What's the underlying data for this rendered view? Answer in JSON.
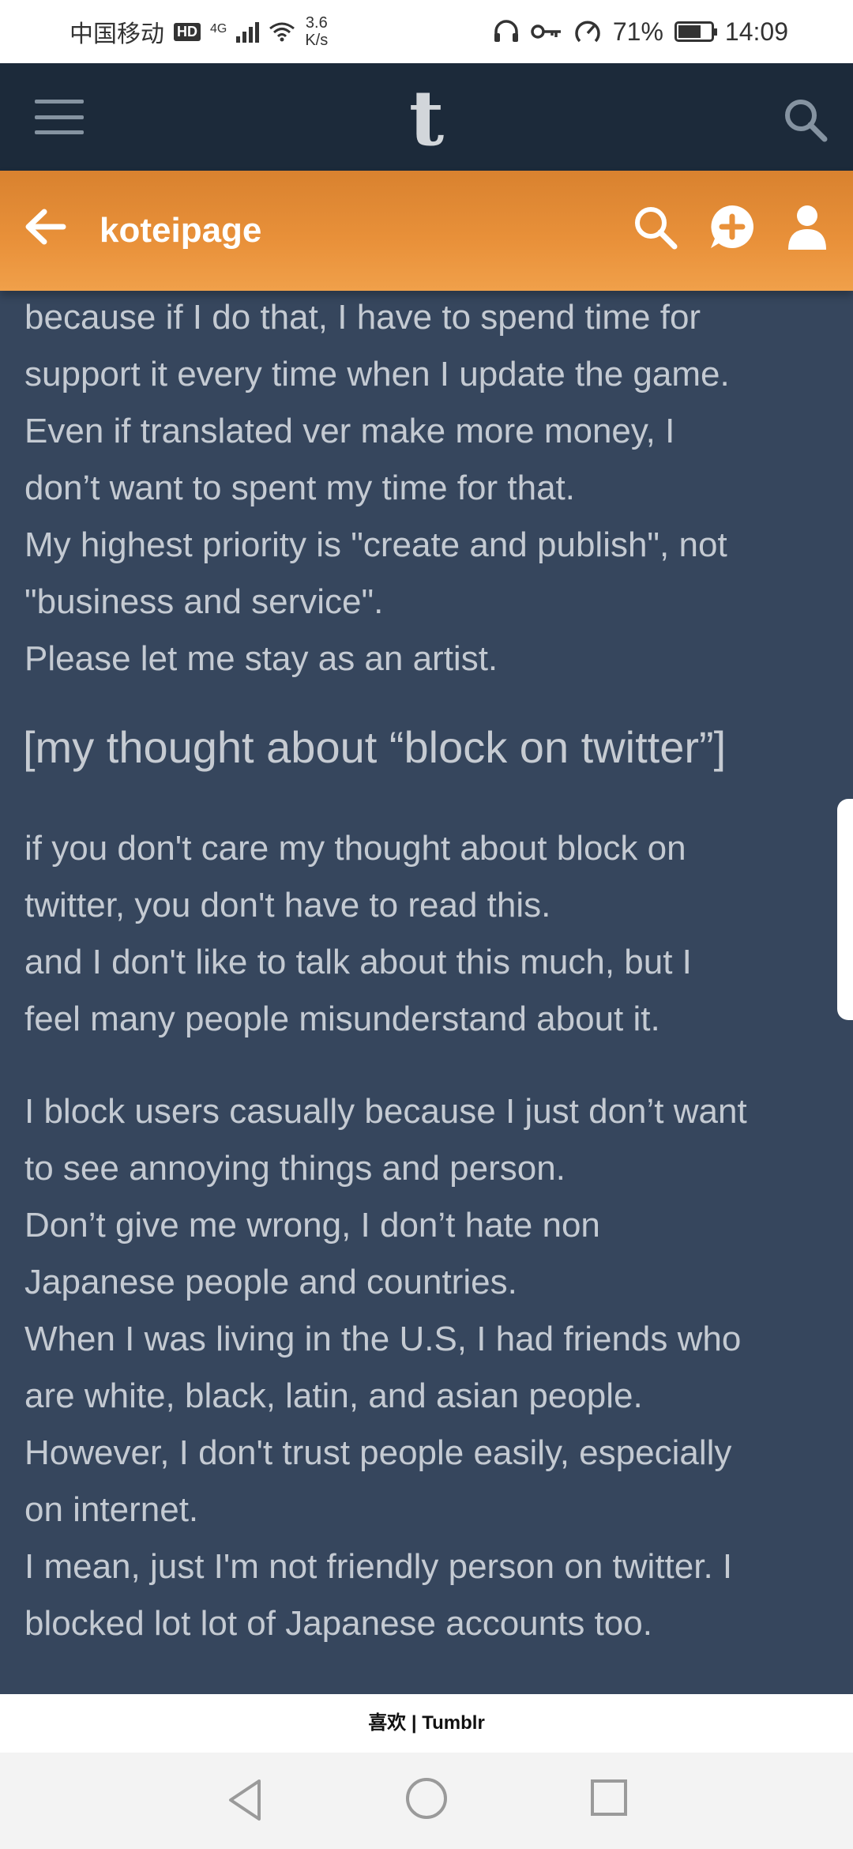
{
  "status_bar": {
    "carrier": "中国移动",
    "hd_badge": "HD",
    "network_type": "4G",
    "speed_value": "3.6",
    "speed_unit": "K/s",
    "battery_percent": "71%",
    "time": "14:09"
  },
  "app_bar": {
    "logo": "t"
  },
  "blog_header": {
    "blog_name": "koteipage"
  },
  "post": {
    "cut_off_text": "...",
    "paragraph1": [
      "because if I do that, I have to spend time for",
      "support it every time when I update the game.",
      "Even if translated ver make more money, I",
      "don’t want to spent my time for that.",
      "My highest priority is \"create and publish\", not",
      "\"business and service\".",
      "Please let me stay as an artist."
    ],
    "heading": "[my thought about “block on twitter”]",
    "paragraph2": [
      "if you don't care my thought about block on",
      "twitter, you don't have to read this.",
      "and I don't like to talk about this much, but I",
      "feel many people misunderstand about it."
    ],
    "paragraph3": [
      "I block users casually because I just don’t want",
      "to see annoying things and person.",
      "Don’t give me wrong, I don’t hate non",
      "Japanese people and countries.",
      "When I was living in the U.S, I had friends who",
      "are white, black, latin, and asian people.",
      "However, I don't trust people easily, especially",
      "on internet.",
      "I mean, just I'm not friendly person on twitter. I",
      "blocked lot lot of Japanese accounts too."
    ]
  },
  "footer": {
    "text": "喜欢 | Tumblr"
  },
  "colors": {
    "content_bg": "#36465d",
    "app_bar_bg": "#1c2a3a",
    "header_orange": "#e9913a",
    "text": "#c4cad2"
  }
}
